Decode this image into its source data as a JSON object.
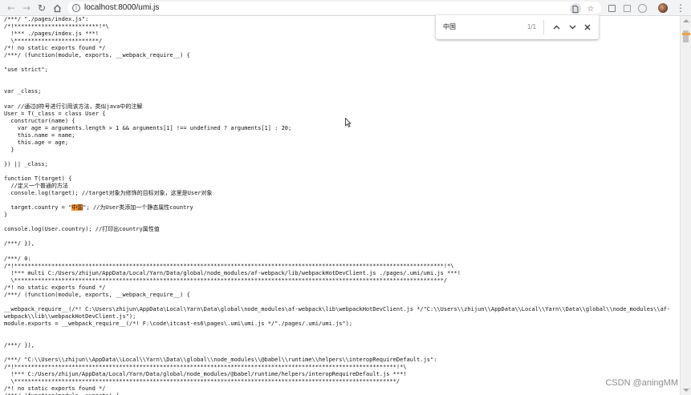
{
  "browser": {
    "url": "localhost:8000/umi.js",
    "back_icon": "arrow-left-icon",
    "forward_icon": "arrow-right-icon",
    "reload_icon": "reload-icon",
    "home_icon": "home-icon"
  },
  "find_bar": {
    "query": "中国",
    "count": "1/1"
  },
  "code": {
    "lines": [
      "/***/ \"./pages/index.js\":",
      "/*!*************************!*\\",
      "  !*** ./pages/index.js ***!",
      "  \\*************************/",
      "/*! no static exports found */",
      "/***/ (function(module, exports, __webpack_require__) {",
      "",
      "\"use strict\";",
      "",
      "",
      "var _class;",
      "",
      "var //通过@符号进行引用该方法，类似java中的注解",
      "User = T(_class = class User {",
      "  constructor(name) {",
      "    var age = arguments.length > 1 && arguments[1] !== undefined ? arguments[1] : 20;",
      "    this.name = name;",
      "    this.age = age;",
      "  }",
      "",
      "}) || _class;",
      "",
      "function T(target) {",
      "  //定义一个普通的方法",
      "  console.log(target); //target对象为修饰的目标对象，这里是User对象",
      "",
      "  target.country = \"中国\"; //为User类添加一个静态属性country",
      "}",
      "",
      "console.log(User.country); //打印出country属性值",
      "",
      "/***/ }),",
      "",
      "/***/ 0:",
      "/*!*******************************************************************************************************************************!*\\",
      "  !*** multi C:/Users/zhijun/AppData/Local/Yarn/Data/global/node_modules/af-webpack/lib/webpackHotDevClient.js ./pages/.umi/umi.js ***!",
      "  \\*******************************************************************************************************************************/",
      "/*! no static exports found */",
      "/***/ (function(module, exports, __webpack_require__) {",
      "",
      "__webpack_require__(/*! C:\\Users\\zhijun\\AppData\\Local\\Yarn\\Data\\global\\node_modules\\af-webpack\\lib\\webpackHotDevClient.js */\"C:\\\\Users\\\\zhijun\\\\AppData\\\\Local\\\\Yarn\\\\Data\\\\global\\\\node_modules\\\\af-",
      "webpack\\\\lib\\\\webpackHotDevClient.js\");",
      "module.exports = __webpack_require__(/*! F:\\code\\itcast-es6\\pages\\.umi\\umi.js */\"./pages/.umi/umi.js\");",
      "",
      "",
      "/***/ }),",
      "",
      "/***/ \"C:\\\\Users\\\\zhijun\\\\AppData\\\\Local\\\\Yarn\\\\Data\\\\global\\\\node_modules\\\\@babel\\\\runtime\\\\helpers\\\\interopRequireDefault.js\":",
      "/*!*****************************************************************************************************************!*\\",
      "  !*** C:/Users/zhijun/AppData/Local/Yarn/Data/global/node_modules/@babel/runtime/helpers/interopRequireDefault.js ***!",
      "  \\*****************************************************************************************************************/",
      "/*! no static exports found */",
      "/***/ (function(module, exports) {"
    ]
  },
  "watermark": "CSDN @aningMM"
}
